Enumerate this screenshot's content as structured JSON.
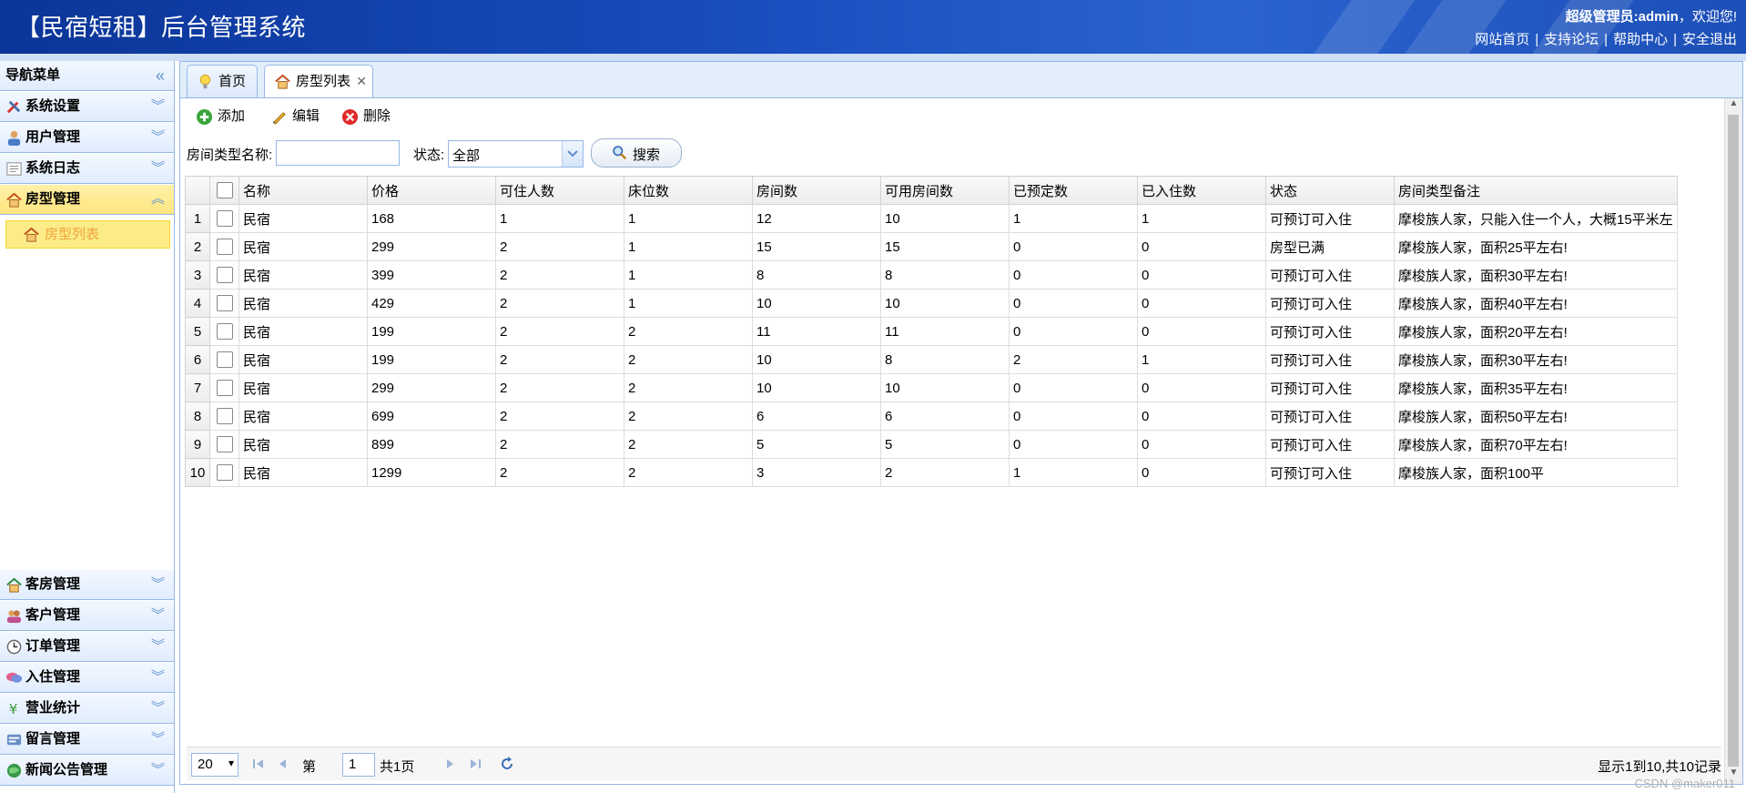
{
  "header": {
    "app_title": "【民宿短租】后台管理系统",
    "welcome_user": "超级管理员:admin",
    "welcome_suffix": "，欢迎您!",
    "links": [
      "网站首页",
      "支持论坛",
      "帮助中心",
      "安全退出"
    ]
  },
  "sidebar": {
    "title": "导航菜单",
    "collapse_icon": "double-chevron-left-icon",
    "top_items": [
      {
        "label": "系统设置",
        "icon": "tools-icon"
      },
      {
        "label": "用户管理",
        "icon": "user-icon"
      },
      {
        "label": "系统日志",
        "icon": "log-icon"
      },
      {
        "label": "房型管理",
        "icon": "house-icon",
        "active": true
      }
    ],
    "sub_item": {
      "label": "房型列表",
      "icon": "house-icon"
    },
    "bottom_items": [
      {
        "label": "客房管理",
        "icon": "house-icon"
      },
      {
        "label": "客户管理",
        "icon": "users-icon"
      },
      {
        "label": "订单管理",
        "icon": "clock-icon"
      },
      {
        "label": "入住管理",
        "icon": "chat-icon"
      },
      {
        "label": "营业统计",
        "icon": "yen-icon"
      },
      {
        "label": "留言管理",
        "icon": "message-icon"
      },
      {
        "label": "新闻公告管理",
        "icon": "globe-icon"
      }
    ]
  },
  "tabs": [
    {
      "label": "首页",
      "icon": "lightbulb-icon"
    },
    {
      "label": "房型列表",
      "icon": "house-icon",
      "closable": true
    }
  ],
  "toolbar": {
    "add_label": "添加",
    "edit_label": "编辑",
    "delete_label": "删除"
  },
  "search": {
    "name_label": "房间类型名称:",
    "name_value": "",
    "status_label": "状态:",
    "status_value": "全部",
    "button_label": "搜索"
  },
  "table": {
    "columns": [
      "名称",
      "价格",
      "可住人数",
      "床位数",
      "房间数",
      "可用房间数",
      "已预定数",
      "已入住数",
      "状态",
      "房间类型备注"
    ],
    "rows": [
      [
        "民宿",
        "168",
        "1",
        "1",
        "12",
        "10",
        "1",
        "1",
        "可预订可入住",
        "摩梭族人家，只能入住一个人，大概15平米左"
      ],
      [
        "民宿",
        "299",
        "2",
        "1",
        "15",
        "15",
        "0",
        "0",
        "房型已满",
        "摩梭族人家，面积25平左右!"
      ],
      [
        "民宿",
        "399",
        "2",
        "1",
        "8",
        "8",
        "0",
        "0",
        "可预订可入住",
        "摩梭族人家，面积30平左右!"
      ],
      [
        "民宿",
        "429",
        "2",
        "1",
        "10",
        "10",
        "0",
        "0",
        "可预订可入住",
        "摩梭族人家，面积40平左右!"
      ],
      [
        "民宿",
        "199",
        "2",
        "2",
        "11",
        "11",
        "0",
        "0",
        "可预订可入住",
        "摩梭族人家，面积20平左右!"
      ],
      [
        "民宿",
        "199",
        "2",
        "2",
        "10",
        "8",
        "2",
        "1",
        "可预订可入住",
        "摩梭族人家，面积30平左右!"
      ],
      [
        "民宿",
        "299",
        "2",
        "2",
        "10",
        "10",
        "0",
        "0",
        "可预订可入住",
        "摩梭族人家，面积35平左右!"
      ],
      [
        "民宿",
        "699",
        "2",
        "2",
        "6",
        "6",
        "0",
        "0",
        "可预订可入住",
        "摩梭族人家，面积50平左右!"
      ],
      [
        "民宿",
        "899",
        "2",
        "2",
        "5",
        "5",
        "0",
        "0",
        "可预订可入住",
        "摩梭族人家，面积70平左右!"
      ],
      [
        "民宿",
        "1299",
        "2",
        "2",
        "3",
        "2",
        "1",
        "0",
        "可预订可入住",
        "摩梭族人家，面积100平"
      ]
    ]
  },
  "pager": {
    "page_size": "20",
    "page_prefix": "第",
    "page_value": "1",
    "page_suffix": "共1页",
    "info": "显示1到10,共10记录"
  },
  "watermark": "CSDN @maker011",
  "colors": {
    "header_blue": "#1a4fbf",
    "active_yellow": "#ffe57e",
    "border_blue": "#95b8e7"
  }
}
